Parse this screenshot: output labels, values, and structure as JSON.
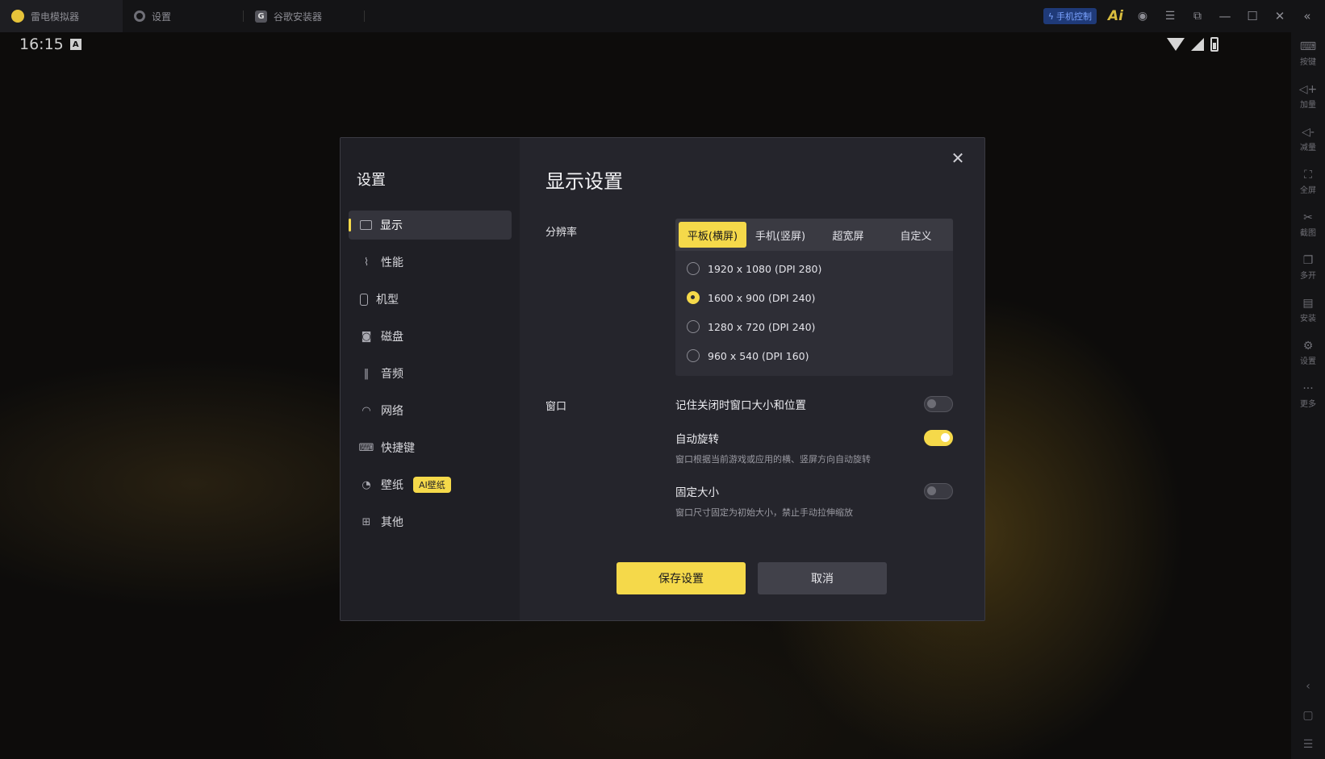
{
  "titlebar": {
    "tabs": [
      {
        "label": "雷电模拟器",
        "icon": "ld-logo-icon"
      },
      {
        "label": "设置",
        "icon": "gear-icon"
      },
      {
        "label": "谷歌安装器",
        "icon": "g-logo-icon"
      }
    ],
    "phone_control": "手机控制",
    "ai_label": "Ai"
  },
  "statusbar": {
    "time": "16:15",
    "badge": "A"
  },
  "rightbar": {
    "items": [
      {
        "label": "按键",
        "icon": "keyboard-icon"
      },
      {
        "label": "加量",
        "icon": "volume-up-icon"
      },
      {
        "label": "减量",
        "icon": "volume-down-icon"
      },
      {
        "label": "全屏",
        "icon": "fullscreen-icon"
      },
      {
        "label": "截图",
        "icon": "scissors-icon"
      },
      {
        "label": "多开",
        "icon": "multi-instance-icon"
      },
      {
        "label": "安装",
        "icon": "install-icon"
      },
      {
        "label": "设置",
        "icon": "gear-icon"
      },
      {
        "label": "更多",
        "icon": "more-icon"
      }
    ]
  },
  "dialog": {
    "sidebar_title": "设置",
    "nav": [
      {
        "label": "显示",
        "icon": "monitor-icon"
      },
      {
        "label": "性能",
        "icon": "performance-icon"
      },
      {
        "label": "机型",
        "icon": "phone-icon"
      },
      {
        "label": "磁盘",
        "icon": "disk-icon"
      },
      {
        "label": "音频",
        "icon": "audio-icon"
      },
      {
        "label": "网络",
        "icon": "wifi-icon"
      },
      {
        "label": "快捷键",
        "icon": "keyboard-icon"
      },
      {
        "label": "壁纸",
        "icon": "palette-icon",
        "badge": "AI壁纸"
      },
      {
        "label": "其他",
        "icon": "grid-icon"
      }
    ],
    "title": "显示设置",
    "resolution": {
      "label": "分辨率",
      "tabs": [
        "平板(横屏)",
        "手机(竖屏)",
        "超宽屏",
        "自定义"
      ],
      "selected_tab": "平板(横屏)",
      "options": [
        "1920 x 1080  (DPI 280)",
        "1600 x 900  (DPI 240)",
        "1280 x 720  (DPI 240)",
        "960 x 540  (DPI 160)"
      ],
      "selected_option": "1600 x 900  (DPI 240)"
    },
    "window": {
      "label": "窗口",
      "remember": {
        "name": "记住关闭时窗口大小和位置",
        "enabled": false
      },
      "auto_rotate": {
        "name": "自动旋转",
        "desc": "窗口根据当前游戏或应用的横、竖屏方向自动旋转",
        "enabled": true
      },
      "fixed_size": {
        "name": "固定大小",
        "desc": "窗口尺寸固定为初始大小，禁止手动拉伸缩放",
        "enabled": false
      }
    },
    "save_label": "保存设置",
    "cancel_label": "取消"
  },
  "colors": {
    "accent": "#f5d94a",
    "dialog_bg": "#25252c",
    "sidebar_bg": "#1f1f25"
  }
}
